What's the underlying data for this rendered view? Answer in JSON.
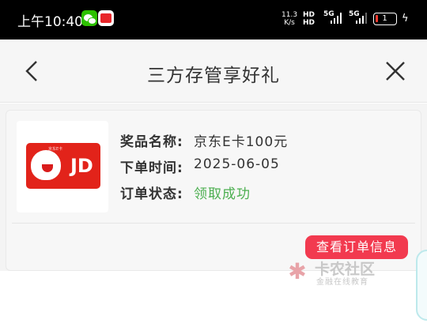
{
  "status_bar": {
    "time": "上午10:40",
    "net_speed_value": "11.3",
    "net_speed_unit": "K/s",
    "hd1": "HD",
    "hd2": "HD",
    "sig1": "5G",
    "sig2": "5G",
    "battery_level": "1",
    "icons": [
      "wechat-icon",
      "bank-app-icon",
      "signal-icon",
      "battery-icon",
      "charging-icon"
    ]
  },
  "header": {
    "title": "三方存管享好礼",
    "back_icon": "chevron-left-icon",
    "close_icon": "close-icon"
  },
  "order": {
    "image_text": "JD",
    "image_top_text": "京东E卡",
    "fields": [
      {
        "label": "奖品名称:",
        "value": "京东E卡100元"
      },
      {
        "label": "下单时间:",
        "value": "2025-06-05"
      },
      {
        "label": "订单状态:",
        "value": "领取成功"
      }
    ],
    "status_color": "#4caf50",
    "action_label": "查看订单信息",
    "action_color": "#f23a4f"
  },
  "watermark": {
    "title": "卡农社区",
    "subtitle": "金融在线教育"
  }
}
